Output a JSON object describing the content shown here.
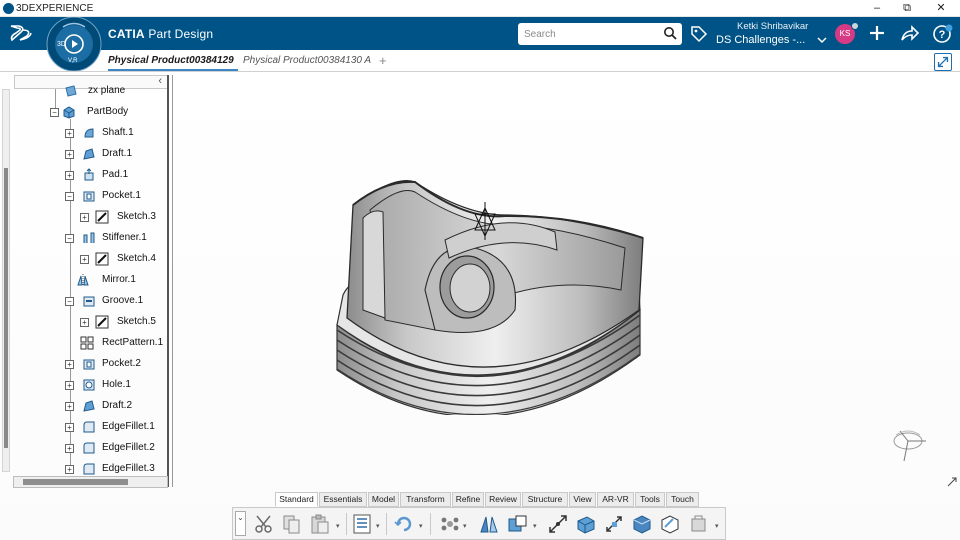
{
  "window": {
    "title": "3DEXPERIENCE",
    "buttons": {
      "minimize": "–",
      "restore": "⧉",
      "close": "✕"
    }
  },
  "header": {
    "brand": "CATIA",
    "app": "Part Design",
    "search_placeholder": "Search",
    "user_name": "Ketki Shribavikar",
    "collab_space": "DS Challenges -...",
    "avatar_initials": "KS",
    "accent_color": "#005386"
  },
  "compass": {
    "labels": {
      "top": "3D",
      "center": "▶",
      "bottom": "V,R"
    }
  },
  "tabs": [
    {
      "label": "Physical Product00384129",
      "active": true
    },
    {
      "label": "Physical Product00384130 A",
      "active": false
    }
  ],
  "tree": {
    "collapse_glyph": "‹",
    "nodes": [
      {
        "label": "zx plane",
        "icon": "plane-icon"
      },
      {
        "label": "PartBody",
        "icon": "partbody-icon"
      },
      {
        "label": "Shaft.1",
        "icon": "shaft-icon"
      },
      {
        "label": "Draft.1",
        "icon": "draft-icon"
      },
      {
        "label": "Pad.1",
        "icon": "pad-icon"
      },
      {
        "label": "Pocket.1",
        "icon": "pocket-icon"
      },
      {
        "label": "Sketch.3",
        "icon": "sketch-icon"
      },
      {
        "label": "Stiffener.1",
        "icon": "stiffener-icon"
      },
      {
        "label": "Sketch.4",
        "icon": "sketch-icon"
      },
      {
        "label": "Mirror.1",
        "icon": "mirror-icon"
      },
      {
        "label": "Groove.1",
        "icon": "groove-icon"
      },
      {
        "label": "Sketch.5",
        "icon": "sketch-icon"
      },
      {
        "label": "RectPattern.1",
        "icon": "pattern-icon"
      },
      {
        "label": "Pocket.2",
        "icon": "pocket-icon"
      },
      {
        "label": "Hole.1",
        "icon": "hole-icon"
      },
      {
        "label": "Draft.2",
        "icon": "draft-icon"
      },
      {
        "label": "EdgeFillet.1",
        "icon": "fillet-icon"
      },
      {
        "label": "EdgeFillet.2",
        "icon": "fillet-icon"
      },
      {
        "label": "EdgeFillet.3",
        "icon": "fillet-icon"
      }
    ]
  },
  "section_tabs": [
    "Standard",
    "Essentials",
    "Model",
    "Transform",
    "Refine",
    "Review",
    "Structure",
    "View",
    "AR-VR",
    "Tools",
    "Touch"
  ],
  "active_section": "Standard",
  "action_bar": {
    "toggle_glyph": "⌄",
    "tools": [
      "cut-icon",
      "copy-icon",
      "paste-icon",
      "properties-icon",
      "update-icon",
      "pattern-icon",
      "mirror-icon",
      "extract-icon",
      "translate-icon",
      "box-icon",
      "measure-icon",
      "cube-icon",
      "transform-icon",
      "tools-icon"
    ]
  }
}
